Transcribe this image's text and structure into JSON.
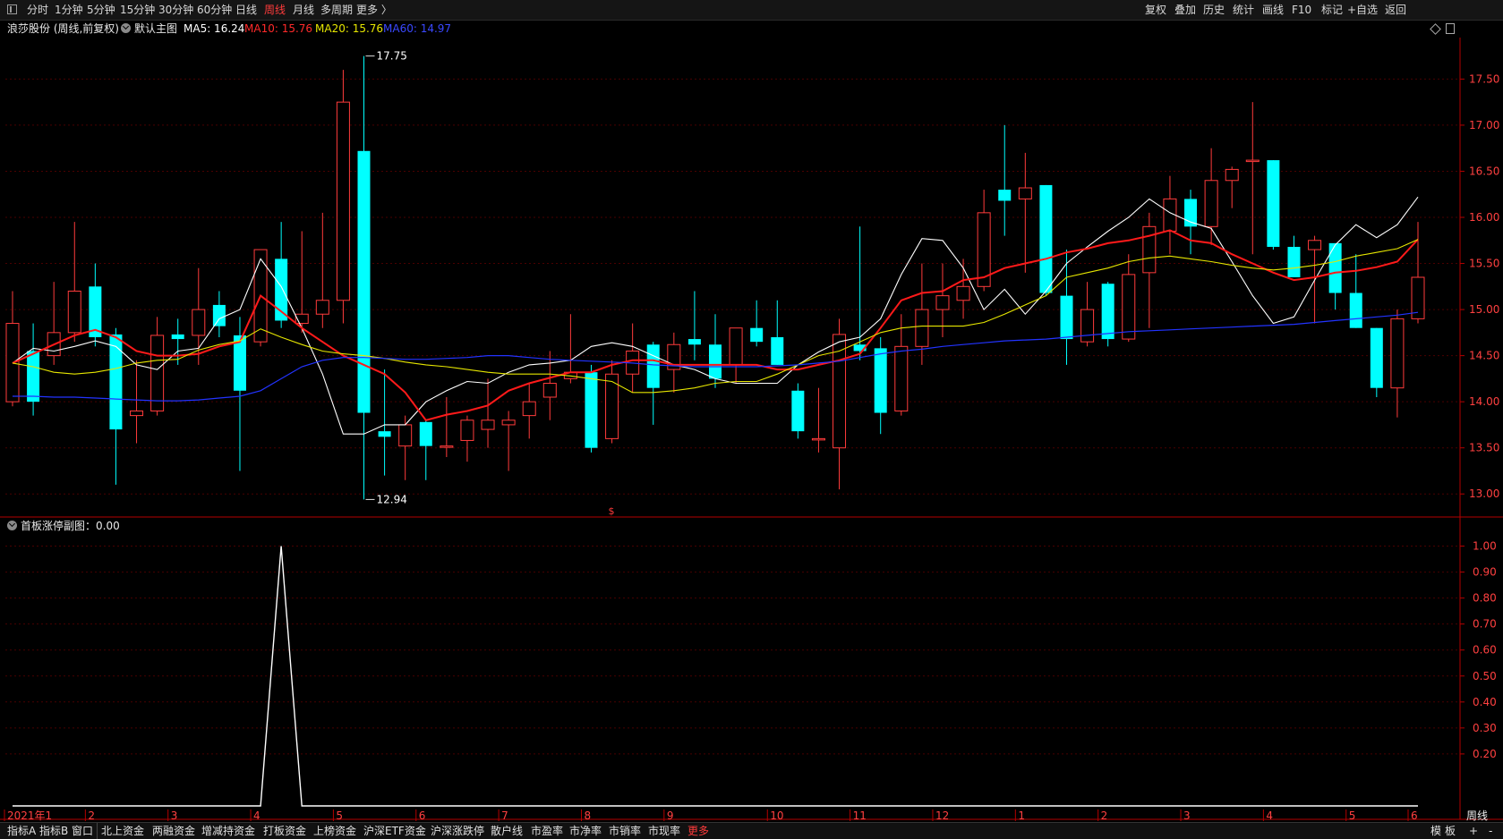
{
  "toolbar": {
    "periods": [
      "分时",
      "1分钟",
      "5分钟",
      "15分钟",
      "30分钟",
      "60分钟",
      "日线",
      "周线",
      "月线",
      "多周期",
      "更多 〉"
    ],
    "active_period": "周线",
    "right_buttons": [
      "复权",
      "叠加",
      "历史",
      "统计",
      "画线",
      "F10",
      "标记",
      "+自选",
      "返回"
    ]
  },
  "info": {
    "stock_label": "浪莎股份 (周线,前复权)",
    "main_chart_label": "默认主图",
    "ma5": "MA5: 16.24",
    "ma10": "MA10: 15.76",
    "ma20": "MA20: 15.76",
    "ma60": "MA60: 14.97"
  },
  "sub": {
    "title": "首板涨停副图：0.00"
  },
  "bottom": {
    "items": [
      "指标A",
      "指标B",
      "窗口",
      "北上资金",
      "两融资金",
      "增减持资金",
      "打板资金",
      "上榜资金",
      "沪深ETF资金",
      "沪深涨跌停",
      "散户线",
      "市盈率",
      "市净率",
      "市销率",
      "市现率",
      "更多"
    ],
    "highlight": "更多",
    "right": [
      "模",
      "板",
      "+",
      "-"
    ]
  },
  "colors": {
    "up": "#ff3b3b",
    "down": "#00ffff",
    "ma5": "#ffffff",
    "ma10": "#ff1a1a",
    "ma20": "#e6e600",
    "ma60": "#2233ff",
    "grid": "#4a0000",
    "axis": "#b40000",
    "label": "#ff4040"
  },
  "chart_data": [
    {
      "type": "candlestick",
      "period_label": "周线",
      "x_labels": [
        "2021年1",
        "2",
        "3",
        "4",
        "5",
        "6",
        "7",
        "8",
        "9",
        "10",
        "11",
        "12",
        "1",
        "2",
        "3",
        "4",
        "5",
        "6"
      ],
      "ylim": [
        12.75,
        17.95
      ],
      "yticks": [
        13.0,
        13.5,
        14.0,
        14.5,
        15.0,
        15.5,
        16.0,
        16.5,
        17.0,
        17.5
      ],
      "annotations": [
        {
          "label": "17.75",
          "value": 17.75,
          "type": "high"
        },
        {
          "label": "12.94",
          "value": 12.94,
          "type": "low"
        }
      ],
      "series": [
        {
          "name": "MA5",
          "values": [
            14.42,
            14.58,
            14.55,
            14.6,
            14.66,
            14.6,
            14.4,
            14.35,
            14.55,
            14.58,
            14.9,
            15.0,
            15.55,
            15.25,
            14.8,
            14.3,
            13.65,
            13.65,
            13.75,
            13.75,
            14.0,
            14.12,
            14.22,
            14.2,
            14.32,
            14.4,
            14.42,
            14.45,
            14.6,
            14.64,
            14.6,
            14.5,
            14.4,
            14.35,
            14.25,
            14.2,
            14.2,
            14.2,
            14.4,
            14.54,
            14.65,
            14.7,
            14.9,
            15.38,
            15.77,
            15.75,
            15.45,
            15.0,
            15.22,
            14.95,
            15.2,
            15.5,
            15.68,
            15.85,
            16.0,
            16.2,
            16.05,
            15.95,
            15.88,
            15.52,
            15.15,
            14.85,
            14.92,
            15.32,
            15.7,
            15.92,
            15.78,
            15.92,
            16.22
          ]
        },
        {
          "name": "MA10",
          "values": [
            14.42,
            14.52,
            14.62,
            14.72,
            14.78,
            14.7,
            14.55,
            14.5,
            14.5,
            14.52,
            14.6,
            14.65,
            15.15,
            14.98,
            14.8,
            14.65,
            14.5,
            14.4,
            14.3,
            14.1,
            13.8,
            13.86,
            13.9,
            13.96,
            14.12,
            14.2,
            14.26,
            14.32,
            14.32,
            14.4,
            14.45,
            14.45,
            14.4,
            14.4,
            14.4,
            14.4,
            14.4,
            14.35,
            14.35,
            14.4,
            14.45,
            14.52,
            14.8,
            15.1,
            15.18,
            15.2,
            15.32,
            15.35,
            15.45,
            15.5,
            15.55,
            15.62,
            15.66,
            15.72,
            15.75,
            15.8,
            15.86,
            15.75,
            15.72,
            15.6,
            15.5,
            15.4,
            15.32,
            15.35,
            15.4,
            15.42,
            15.46,
            15.52,
            15.76
          ]
        },
        {
          "name": "MA20",
          "values": [
            14.42,
            14.38,
            14.32,
            14.3,
            14.32,
            14.36,
            14.42,
            14.45,
            14.46,
            14.56,
            14.62,
            14.66,
            14.79,
            14.7,
            14.62,
            14.55,
            14.52,
            14.5,
            14.47,
            14.43,
            14.4,
            14.38,
            14.35,
            14.32,
            14.3,
            14.3,
            14.3,
            14.28,
            14.25,
            14.22,
            14.1,
            14.1,
            14.12,
            14.15,
            14.2,
            14.22,
            14.22,
            14.3,
            14.4,
            14.5,
            14.55,
            14.65,
            14.75,
            14.8,
            14.82,
            14.82,
            14.82,
            14.86,
            14.95,
            15.05,
            15.15,
            15.35,
            15.4,
            15.45,
            15.52,
            15.56,
            15.58,
            15.55,
            15.52,
            15.48,
            15.45,
            15.43,
            15.45,
            15.48,
            15.52,
            15.58,
            15.62,
            15.66,
            15.76
          ]
        },
        {
          "name": "MA60",
          "values": [
            14.06,
            14.06,
            14.05,
            14.05,
            14.04,
            14.03,
            14.02,
            14.01,
            14.01,
            14.02,
            14.04,
            14.06,
            14.12,
            14.25,
            14.38,
            14.45,
            14.48,
            14.48,
            14.47,
            14.46,
            14.46,
            14.47,
            14.48,
            14.5,
            14.5,
            14.48,
            14.46,
            14.45,
            14.44,
            14.43,
            14.42,
            14.4,
            14.39,
            14.38,
            14.38,
            14.38,
            14.38,
            14.39,
            14.4,
            14.42,
            14.44,
            14.48,
            14.52,
            14.55,
            14.57,
            14.6,
            14.62,
            14.64,
            14.66,
            14.67,
            14.68,
            14.7,
            14.72,
            14.74,
            14.76,
            14.77,
            14.78,
            14.79,
            14.8,
            14.81,
            14.82,
            14.83,
            14.84,
            14.86,
            14.88,
            14.9,
            14.92,
            14.94,
            14.97
          ]
        }
      ],
      "candles": [
        {
          "o": 14.0,
          "h": 15.2,
          "l": 13.95,
          "c": 14.85
        },
        {
          "o": 14.55,
          "h": 14.85,
          "l": 13.85,
          "c": 14.0
        },
        {
          "o": 14.5,
          "h": 15.3,
          "l": 14.4,
          "c": 14.75
        },
        {
          "o": 14.75,
          "h": 15.95,
          "l": 14.65,
          "c": 15.2
        },
        {
          "o": 15.25,
          "h": 15.5,
          "l": 14.6,
          "c": 14.7
        },
        {
          "o": 14.73,
          "h": 14.8,
          "l": 13.1,
          "c": 13.7
        },
        {
          "o": 13.85,
          "h": 14.45,
          "l": 13.55,
          "c": 13.9
        },
        {
          "o": 13.9,
          "h": 14.92,
          "l": 13.85,
          "c": 14.72
        },
        {
          "o": 14.73,
          "h": 14.9,
          "l": 14.4,
          "c": 14.68
        },
        {
          "o": 14.72,
          "h": 15.45,
          "l": 14.4,
          "c": 15.0
        },
        {
          "o": 15.05,
          "h": 15.2,
          "l": 14.7,
          "c": 14.82
        },
        {
          "o": 14.72,
          "h": 14.92,
          "l": 13.25,
          "c": 14.12
        },
        {
          "o": 14.65,
          "h": 15.65,
          "l": 14.6,
          "c": 15.65
        },
        {
          "o": 15.55,
          "h": 15.95,
          "l": 14.8,
          "c": 14.88
        },
        {
          "o": 14.85,
          "h": 15.85,
          "l": 14.75,
          "c": 14.95
        },
        {
          "o": 14.95,
          "h": 16.05,
          "l": 14.8,
          "c": 15.1
        },
        {
          "o": 15.1,
          "h": 17.6,
          "l": 14.85,
          "c": 17.25
        },
        {
          "o": 16.72,
          "h": 17.75,
          "l": 12.94,
          "c": 13.88
        },
        {
          "o": 13.68,
          "h": 14.35,
          "l": 13.2,
          "c": 13.62
        },
        {
          "o": 13.52,
          "h": 13.85,
          "l": 13.15,
          "c": 13.75
        },
        {
          "o": 13.78,
          "h": 13.8,
          "l": 13.15,
          "c": 13.52
        },
        {
          "o": 13.52,
          "h": 14.05,
          "l": 13.4,
          "c": 13.52
        },
        {
          "o": 13.58,
          "h": 13.85,
          "l": 13.35,
          "c": 13.8
        },
        {
          "o": 13.7,
          "h": 14.25,
          "l": 13.5,
          "c": 13.8
        },
        {
          "o": 13.75,
          "h": 13.9,
          "l": 13.25,
          "c": 13.8
        },
        {
          "o": 13.85,
          "h": 14.2,
          "l": 13.6,
          "c": 14.0
        },
        {
          "o": 14.05,
          "h": 14.55,
          "l": 13.8,
          "c": 14.2
        },
        {
          "o": 14.25,
          "h": 14.95,
          "l": 14.2,
          "c": 14.32
        },
        {
          "o": 14.32,
          "h": 14.4,
          "l": 13.45,
          "c": 13.5
        },
        {
          "o": 13.6,
          "h": 14.45,
          "l": 13.55,
          "c": 14.3
        },
        {
          "o": 14.3,
          "h": 14.85,
          "l": 14.1,
          "c": 14.55
        },
        {
          "o": 14.62,
          "h": 14.65,
          "l": 13.75,
          "c": 14.15
        },
        {
          "o": 14.35,
          "h": 14.75,
          "l": 14.1,
          "c": 14.62
        },
        {
          "o": 14.68,
          "h": 15.2,
          "l": 14.45,
          "c": 14.62
        },
        {
          "o": 14.62,
          "h": 14.95,
          "l": 14.15,
          "c": 14.25
        },
        {
          "o": 14.4,
          "h": 14.8,
          "l": 14.2,
          "c": 14.8
        },
        {
          "o": 14.8,
          "h": 15.1,
          "l": 14.6,
          "c": 14.65
        },
        {
          "o": 14.7,
          "h": 15.1,
          "l": 14.4,
          "c": 14.4
        },
        {
          "o": 14.12,
          "h": 14.2,
          "l": 13.6,
          "c": 13.68
        },
        {
          "o": 13.6,
          "h": 14.15,
          "l": 13.45,
          "c": 13.6
        },
        {
          "o": 13.5,
          "h": 14.9,
          "l": 13.05,
          "c": 14.73
        },
        {
          "o": 14.62,
          "h": 15.9,
          "l": 14.45,
          "c": 14.55
        },
        {
          "o": 14.58,
          "h": 14.7,
          "l": 13.65,
          "c": 13.88
        },
        {
          "o": 13.9,
          "h": 14.95,
          "l": 13.85,
          "c": 14.6
        },
        {
          "o": 14.6,
          "h": 15.5,
          "l": 14.4,
          "c": 15.0
        },
        {
          "o": 15.0,
          "h": 15.5,
          "l": 14.7,
          "c": 15.15
        },
        {
          "o": 15.1,
          "h": 15.55,
          "l": 14.9,
          "c": 15.25
        },
        {
          "o": 15.25,
          "h": 16.3,
          "l": 15.2,
          "c": 16.05
        },
        {
          "o": 16.3,
          "h": 17.0,
          "l": 15.8,
          "c": 16.18
        },
        {
          "o": 16.2,
          "h": 16.7,
          "l": 15.4,
          "c": 16.32
        },
        {
          "o": 16.35,
          "h": 16.35,
          "l": 15.15,
          "c": 15.18
        },
        {
          "o": 15.15,
          "h": 15.65,
          "l": 14.4,
          "c": 14.68
        },
        {
          "o": 14.65,
          "h": 15.3,
          "l": 14.6,
          "c": 15.0
        },
        {
          "o": 15.28,
          "h": 15.3,
          "l": 14.6,
          "c": 14.68
        },
        {
          "o": 14.68,
          "h": 15.6,
          "l": 14.65,
          "c": 15.38
        },
        {
          "o": 15.4,
          "h": 16.05,
          "l": 14.8,
          "c": 15.9
        },
        {
          "o": 15.85,
          "h": 16.45,
          "l": 15.6,
          "c": 16.2
        },
        {
          "o": 16.2,
          "h": 16.3,
          "l": 15.6,
          "c": 15.9
        },
        {
          "o": 15.9,
          "h": 16.75,
          "l": 15.7,
          "c": 16.4
        },
        {
          "o": 16.4,
          "h": 16.55,
          "l": 16.1,
          "c": 16.52
        },
        {
          "o": 16.62,
          "h": 17.25,
          "l": 15.6,
          "c": 16.62
        },
        {
          "o": 16.62,
          "h": 16.62,
          "l": 15.65,
          "c": 15.68
        },
        {
          "o": 15.68,
          "h": 15.8,
          "l": 15.35,
          "c": 15.35
        },
        {
          "o": 15.65,
          "h": 15.8,
          "l": 14.85,
          "c": 15.75
        },
        {
          "o": 15.72,
          "h": 15.72,
          "l": 15.0,
          "c": 15.18
        },
        {
          "o": 15.18,
          "h": 15.6,
          "l": 14.8,
          "c": 14.8
        },
        {
          "o": 14.8,
          "h": 14.8,
          "l": 14.05,
          "c": 14.15
        },
        {
          "o": 14.15,
          "h": 15.0,
          "l": 13.83,
          "c": 14.9
        },
        {
          "o": 14.9,
          "h": 15.95,
          "l": 14.85,
          "c": 15.35
        }
      ]
    },
    {
      "type": "line",
      "name": "首板涨停",
      "ylim": [
        0,
        1.05
      ],
      "yticks": [
        0.2,
        0.3,
        0.4,
        0.5,
        0.6,
        0.7,
        0.8,
        0.9,
        1.0
      ],
      "spike_index": 13,
      "values_note": "0 everywhere except 1.00 at the spike week"
    }
  ]
}
